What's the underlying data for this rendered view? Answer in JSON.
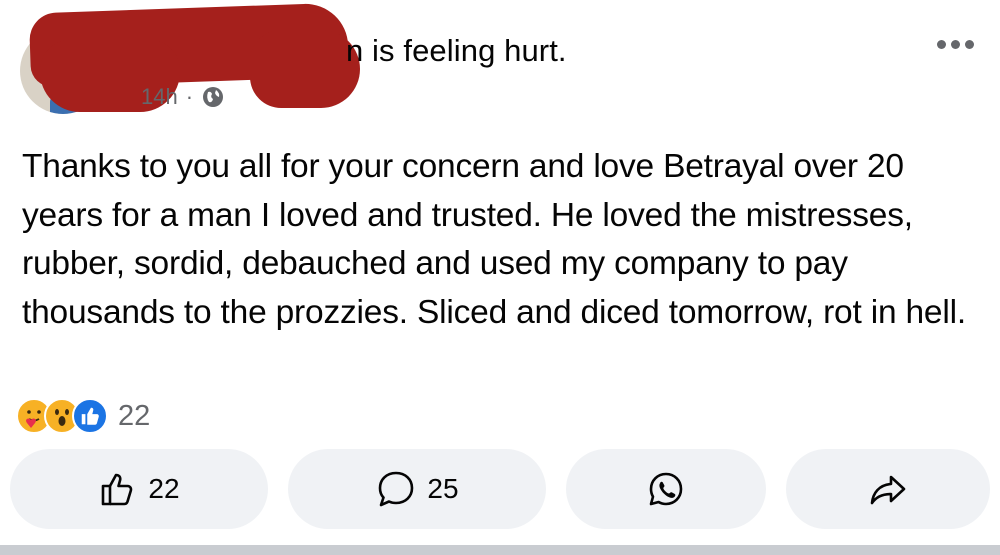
{
  "post": {
    "status_text": "n is feeling hurt.",
    "time_ago": "14h",
    "separator": "·",
    "audience_icon": "globe-icon",
    "menu_icon": "more-icon",
    "body": "Thanks to you all for your concern and love Betrayal over 20 years for a man I loved and trusted. He loved the mistresses, rubber, sordid, debauched and used my company to pay thousands to the prozzies. Sliced and diced tomorrow, rot in hell."
  },
  "reactions": {
    "icons": [
      "care-reaction-icon",
      "wow-reaction-icon",
      "like-reaction-icon"
    ],
    "count": "22"
  },
  "actions": {
    "like_count": "22",
    "comment_count": "25",
    "whatsapp_icon": "whatsapp-icon",
    "share_icon": "share-icon"
  },
  "colors": {
    "accent": "#1b74e4",
    "redaction": "#a5201c",
    "muted_text": "#65676b",
    "button_bg": "#f0f2f5"
  }
}
